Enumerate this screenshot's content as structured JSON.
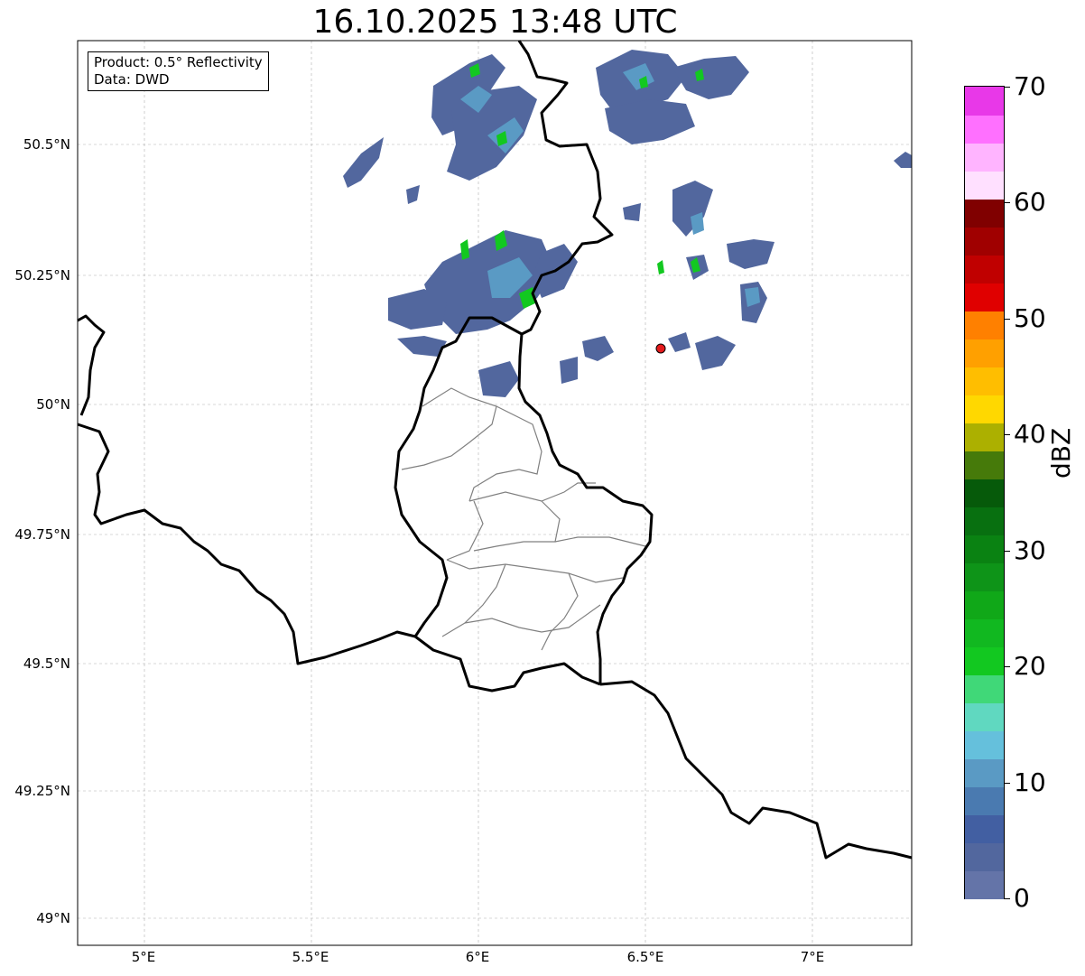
{
  "title": "16.10.2025 13:48 UTC",
  "info_box": {
    "product_line": "Product: 0.5° Reflectivity",
    "data_line": "Data: DWD"
  },
  "map": {
    "lat_ticks": [
      "50.5°N",
      "50.25°N",
      "50°N",
      "49.75°N",
      "49.5°N",
      "49.25°N",
      "49°N"
    ],
    "lon_ticks": [
      "5°E",
      "5.5°E",
      "6°E",
      "6.5°E",
      "7°E"
    ],
    "lon_range": [
      4.8,
      7.3
    ],
    "lat_range": [
      48.95,
      50.7
    ],
    "grid": true,
    "radar_site": {
      "lon": 6.548,
      "lat": 50.11,
      "color": "#e41a1c"
    }
  },
  "colorbar": {
    "label": "dBZ",
    "min": 0,
    "max": 70,
    "tick_labels": [
      "0",
      "10",
      "20",
      "30",
      "40",
      "50",
      "60",
      "70"
    ],
    "tick_values": [
      0,
      10,
      20,
      30,
      40,
      50,
      60,
      70
    ],
    "colors": [
      "#6474a8",
      "#52679e",
      "#425fa2",
      "#4a7ab0",
      "#5a9ac4",
      "#65c0dc",
      "#60d8c0",
      "#40d878",
      "#12c820",
      "#11b820",
      "#10a818",
      "#0e9418",
      "#0a8212",
      "#087010",
      "#065a0a",
      "#467a0a",
      "#acb000",
      "#ffd800",
      "#ffbe00",
      "#ffa000",
      "#ff8000",
      "#e00000",
      "#c00000",
      "#a00000",
      "#800000",
      "#ffe0ff",
      "#ffb4ff",
      "#ff70ff",
      "#e838e8"
    ]
  }
}
